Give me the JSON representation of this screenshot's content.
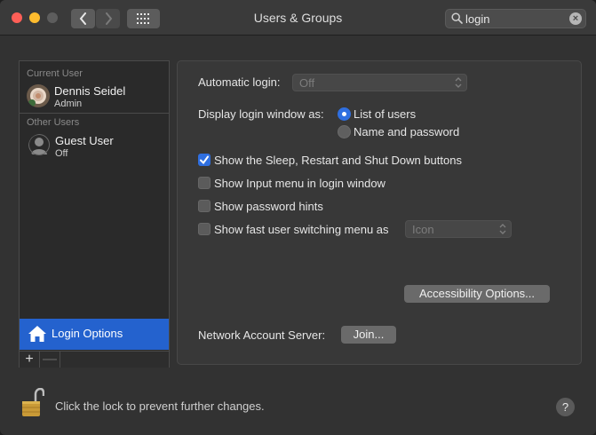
{
  "window": {
    "title": "Users & Groups",
    "search": {
      "query": "login",
      "clear_icon": "×"
    }
  },
  "sidebar": {
    "current_user_header": "Current User",
    "current_user": {
      "name": "Dennis Seidel",
      "role": "Admin"
    },
    "other_users_header": "Other Users",
    "other_users": [
      {
        "name": "Guest User",
        "status": "Off"
      }
    ],
    "login_options_label": "Login Options",
    "add_label": "+",
    "remove_label": "—"
  },
  "panel": {
    "automatic_login": {
      "label": "Automatic login:",
      "value": "Off"
    },
    "display_login_window": {
      "label": "Display login window as:",
      "options": [
        {
          "label": "List of users",
          "selected": true
        },
        {
          "label": "Name and password",
          "selected": false
        }
      ]
    },
    "checkboxes": [
      {
        "label": "Show the Sleep, Restart and Shut Down buttons",
        "checked": true
      },
      {
        "label": "Show Input menu in login window",
        "checked": false
      },
      {
        "label": "Show password hints",
        "checked": false
      },
      {
        "label": "Show fast user switching menu as",
        "checked": false
      }
    ],
    "fast_switch_value": "Icon",
    "accessibility_button": "Accessibility Options...",
    "network_server": {
      "label": "Network Account Server:",
      "button": "Join..."
    }
  },
  "footer": {
    "lock_text": "Click the lock to prevent further changes.",
    "help_label": "?"
  },
  "colors": {
    "accent": "#2f6fe0",
    "selection": "#2462ce"
  }
}
